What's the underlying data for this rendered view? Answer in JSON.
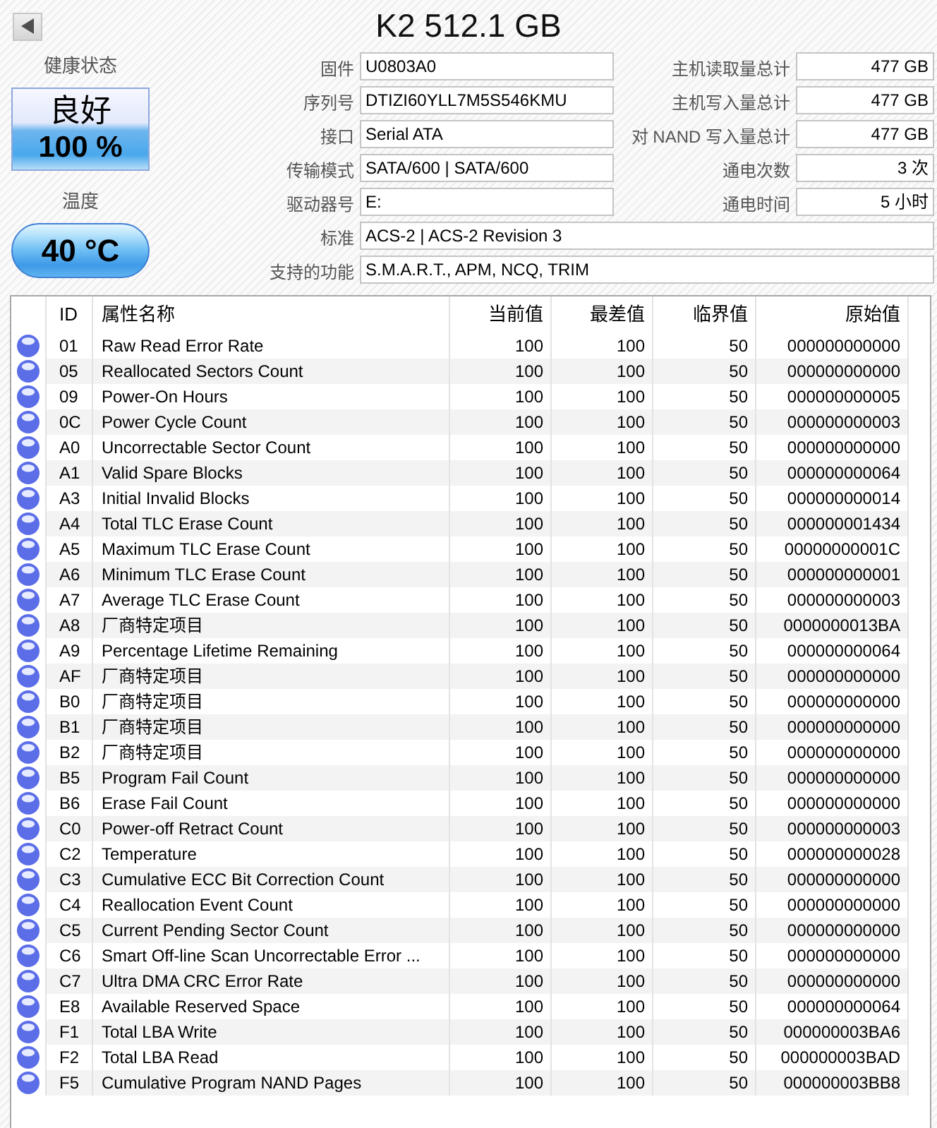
{
  "header": {
    "title": "K2 512.1 GB"
  },
  "health": {
    "label": "健康状态",
    "value": "良好",
    "percent": "100 %"
  },
  "temperature": {
    "label": "温度",
    "value": "40 °C"
  },
  "details": [
    {
      "label": "固件",
      "value": "U0803A0"
    },
    {
      "label": "序列号",
      "value": "DTIZI60YLL7M5S546KMU"
    },
    {
      "label": "接口",
      "value": "Serial ATA"
    },
    {
      "label": "传输模式",
      "value": "SATA/600 | SATA/600"
    },
    {
      "label": "驱动器号",
      "value": "E:"
    },
    {
      "label": "标准",
      "value": "ACS-2 | ACS-2 Revision 3"
    },
    {
      "label": "支持的功能",
      "value": "S.M.A.R.T., APM, NCQ, TRIM"
    }
  ],
  "totals": [
    {
      "label": "主机读取量总计",
      "value": "477 GB"
    },
    {
      "label": "主机写入量总计",
      "value": "477 GB"
    },
    {
      "label": "对 NAND 写入量总计",
      "value": "477 GB"
    },
    {
      "label": "通电次数",
      "value": "3 次"
    },
    {
      "label": "通电时间",
      "value": "5 小时"
    }
  ],
  "smart_table": {
    "columns": [
      "ID",
      "属性名称",
      "当前值",
      "最差值",
      "临界值",
      "原始值"
    ],
    "rows": [
      {
        "color": "#5b6ee8",
        "id": "01",
        "name": "Raw Read Error Rate",
        "current": "100",
        "worst": "100",
        "threshold": "50",
        "raw": "000000000000"
      },
      {
        "color": "#5b6ee8",
        "id": "05",
        "name": "Reallocated Sectors Count",
        "current": "100",
        "worst": "100",
        "threshold": "50",
        "raw": "000000000000"
      },
      {
        "color": "#5b6ee8",
        "id": "09",
        "name": "Power-On Hours",
        "current": "100",
        "worst": "100",
        "threshold": "50",
        "raw": "000000000005"
      },
      {
        "color": "#5b6ee8",
        "id": "0C",
        "name": "Power Cycle Count",
        "current": "100",
        "worst": "100",
        "threshold": "50",
        "raw": "000000000003"
      },
      {
        "color": "#5b6ee8",
        "id": "A0",
        "name": "Uncorrectable Sector Count",
        "current": "100",
        "worst": "100",
        "threshold": "50",
        "raw": "000000000000"
      },
      {
        "color": "#5b6ee8",
        "id": "A1",
        "name": "Valid Spare Blocks",
        "current": "100",
        "worst": "100",
        "threshold": "50",
        "raw": "000000000064"
      },
      {
        "color": "#5b6ee8",
        "id": "A3",
        "name": "Initial Invalid Blocks",
        "current": "100",
        "worst": "100",
        "threshold": "50",
        "raw": "000000000014"
      },
      {
        "color": "#5b6ee8",
        "id": "A4",
        "name": "Total TLC Erase Count",
        "current": "100",
        "worst": "100",
        "threshold": "50",
        "raw": "000000001434"
      },
      {
        "color": "#5b6ee8",
        "id": "A5",
        "name": "Maximum TLC Erase Count",
        "current": "100",
        "worst": "100",
        "threshold": "50",
        "raw": "00000000001C"
      },
      {
        "color": "#5b6ee8",
        "id": "A6",
        "name": "Minimum TLC Erase Count",
        "current": "100",
        "worst": "100",
        "threshold": "50",
        "raw": "000000000001"
      },
      {
        "color": "#5b6ee8",
        "id": "A7",
        "name": "Average TLC Erase Count",
        "current": "100",
        "worst": "100",
        "threshold": "50",
        "raw": "000000000003"
      },
      {
        "color": "#5b6ee8",
        "id": "A8",
        "name": "厂商特定项目",
        "current": "100",
        "worst": "100",
        "threshold": "50",
        "raw": "0000000013BA"
      },
      {
        "color": "#5b6ee8",
        "id": "A9",
        "name": "Percentage Lifetime Remaining",
        "current": "100",
        "worst": "100",
        "threshold": "50",
        "raw": "000000000064"
      },
      {
        "color": "#5b6ee8",
        "id": "AF",
        "name": "厂商特定项目",
        "current": "100",
        "worst": "100",
        "threshold": "50",
        "raw": "000000000000"
      },
      {
        "color": "#5b6ee8",
        "id": "B0",
        "name": "厂商特定项目",
        "current": "100",
        "worst": "100",
        "threshold": "50",
        "raw": "000000000000"
      },
      {
        "color": "#5b6ee8",
        "id": "B1",
        "name": "厂商特定项目",
        "current": "100",
        "worst": "100",
        "threshold": "50",
        "raw": "000000000000"
      },
      {
        "color": "#5b6ee8",
        "id": "B2",
        "name": "厂商特定项目",
        "current": "100",
        "worst": "100",
        "threshold": "50",
        "raw": "000000000000"
      },
      {
        "color": "#5b6ee8",
        "id": "B5",
        "name": "Program Fail Count",
        "current": "100",
        "worst": "100",
        "threshold": "50",
        "raw": "000000000000"
      },
      {
        "color": "#5b6ee8",
        "id": "B6",
        "name": "Erase Fail Count",
        "current": "100",
        "worst": "100",
        "threshold": "50",
        "raw": "000000000000"
      },
      {
        "color": "#5b6ee8",
        "id": "C0",
        "name": "Power-off Retract Count",
        "current": "100",
        "worst": "100",
        "threshold": "50",
        "raw": "000000000003"
      },
      {
        "color": "#5b6ee8",
        "id": "C2",
        "name": "Temperature",
        "current": "100",
        "worst": "100",
        "threshold": "50",
        "raw": "000000000028"
      },
      {
        "color": "#5b6ee8",
        "id": "C3",
        "name": "Cumulative ECC Bit Correction Count",
        "current": "100",
        "worst": "100",
        "threshold": "50",
        "raw": "000000000000"
      },
      {
        "color": "#5b6ee8",
        "id": "C4",
        "name": "Reallocation Event Count",
        "current": "100",
        "worst": "100",
        "threshold": "50",
        "raw": "000000000000"
      },
      {
        "color": "#5b6ee8",
        "id": "C5",
        "name": "Current Pending Sector Count",
        "current": "100",
        "worst": "100",
        "threshold": "50",
        "raw": "000000000000"
      },
      {
        "color": "#5b6ee8",
        "id": "C6",
        "name": "Smart Off-line Scan Uncorrectable Error ...",
        "current": "100",
        "worst": "100",
        "threshold": "50",
        "raw": "000000000000"
      },
      {
        "color": "#5b6ee8",
        "id": "C7",
        "name": "Ultra DMA CRC Error Rate",
        "current": "100",
        "worst": "100",
        "threshold": "50",
        "raw": "000000000000"
      },
      {
        "color": "#5b6ee8",
        "id": "E8",
        "name": "Available Reserved Space",
        "current": "100",
        "worst": "100",
        "threshold": "50",
        "raw": "000000000064"
      },
      {
        "color": "#5b6ee8",
        "id": "F1",
        "name": "Total LBA Write",
        "current": "100",
        "worst": "100",
        "threshold": "50",
        "raw": "000000003BA6"
      },
      {
        "color": "#5b6ee8",
        "id": "F2",
        "name": "Total LBA Read",
        "current": "100",
        "worst": "100",
        "threshold": "50",
        "raw": "000000003BAD"
      },
      {
        "color": "#5b6ee8",
        "id": "F5",
        "name": "Cumulative Program NAND Pages",
        "current": "100",
        "worst": "100",
        "threshold": "50",
        "raw": "000000003BB8"
      }
    ]
  }
}
